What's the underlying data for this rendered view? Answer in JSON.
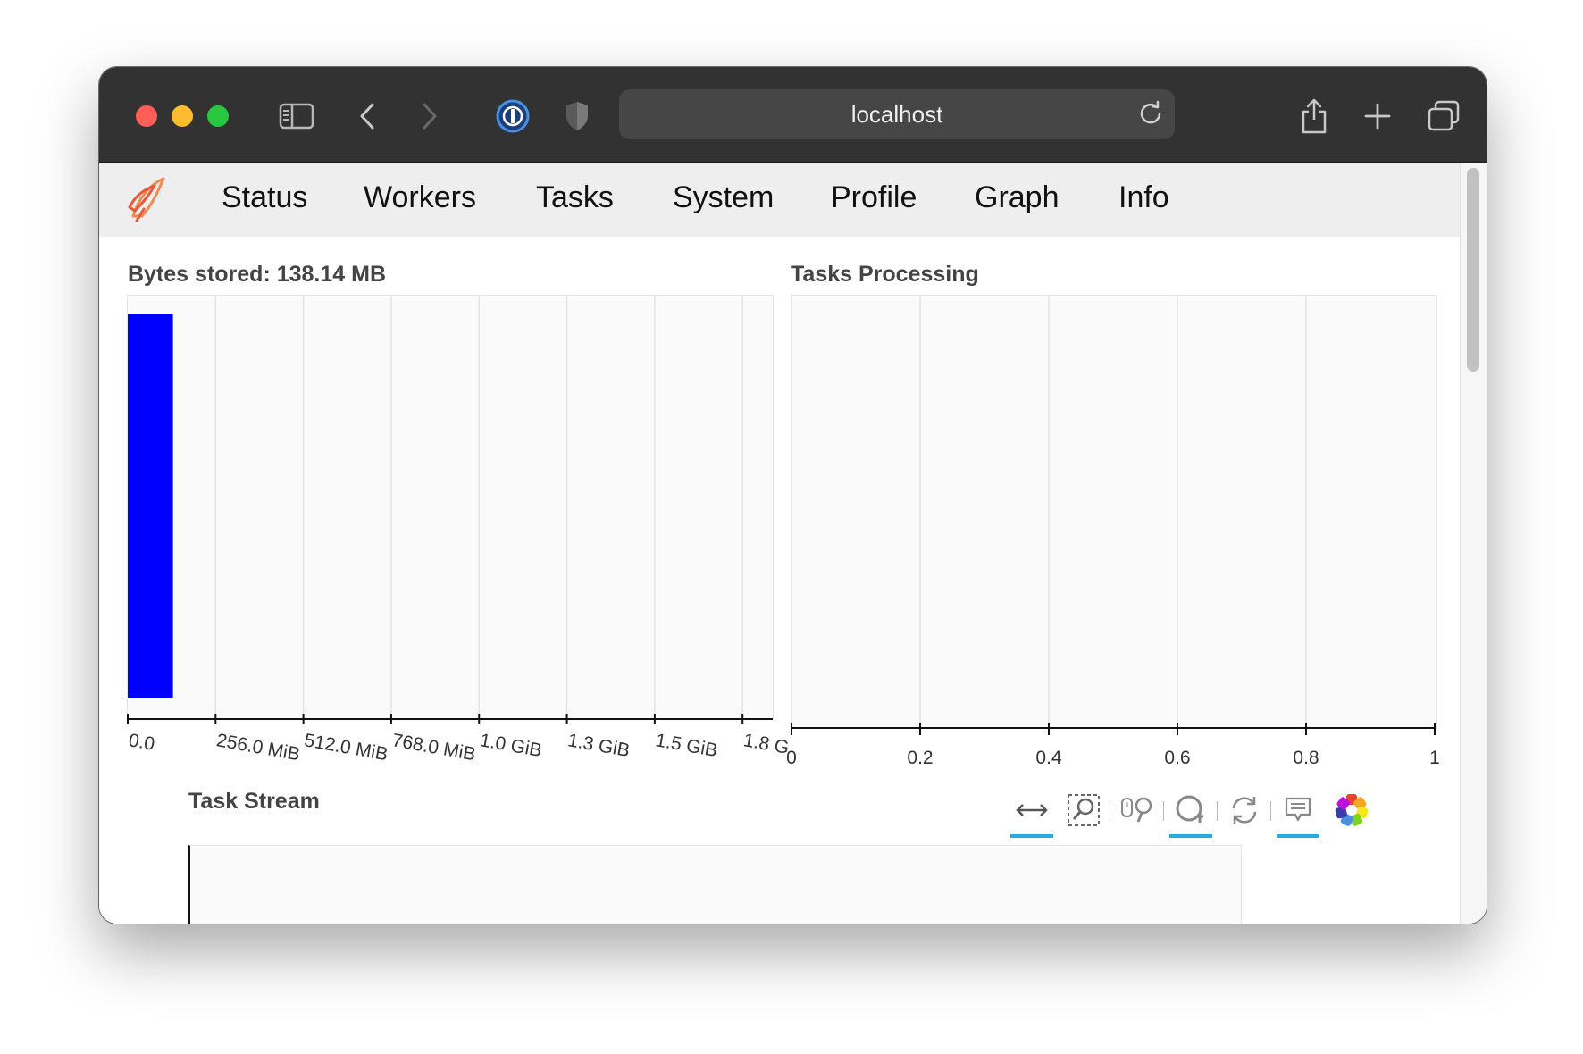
{
  "browser": {
    "address": "localhost"
  },
  "nav": {
    "links": [
      "Status",
      "Workers",
      "Tasks",
      "System",
      "Profile",
      "Graph",
      "Info"
    ]
  },
  "colors": {
    "bar": "#0000ff",
    "tool_active": "#26aae1",
    "titlebar": "#323233"
  },
  "bytes_panel": {
    "title": "Bytes stored: 138.14 MB"
  },
  "tasks_panel": {
    "title": "Tasks Processing"
  },
  "stream_panel": {
    "title": "Task Stream"
  },
  "toolbar_icons": [
    "xpan-icon",
    "box-zoom-icon",
    "wheel-zoom-icon",
    "zoom-in-icon",
    "reset-icon",
    "hover-icon",
    "bokeh-logo-icon"
  ],
  "chart_data": [
    {
      "type": "bar",
      "orientation": "horizontal",
      "title": "Bytes stored: 138.14 MB",
      "values_mib": [
        131.74
      ],
      "xlim_mib": [
        0,
        1880
      ],
      "ticks": [
        "0.0",
        "256.0 MiB",
        "512.0 MiB",
        "768.0 MiB",
        "1.0 GiB",
        "1.3 GiB",
        "1.5 GiB",
        "1.8 G"
      ],
      "tick_values_mib": [
        0,
        256,
        512,
        768,
        1024,
        1280,
        1536,
        1792
      ],
      "grid": true
    },
    {
      "type": "bar",
      "orientation": "horizontal",
      "title": "Tasks Processing",
      "values": [],
      "xlim": [
        0,
        1
      ],
      "ticks": [
        "0",
        "0.2",
        "0.4",
        "0.6",
        "0.8",
        "1"
      ],
      "tick_values": [
        0,
        0.2,
        0.4,
        0.6,
        0.8,
        1
      ],
      "grid": true
    }
  ]
}
